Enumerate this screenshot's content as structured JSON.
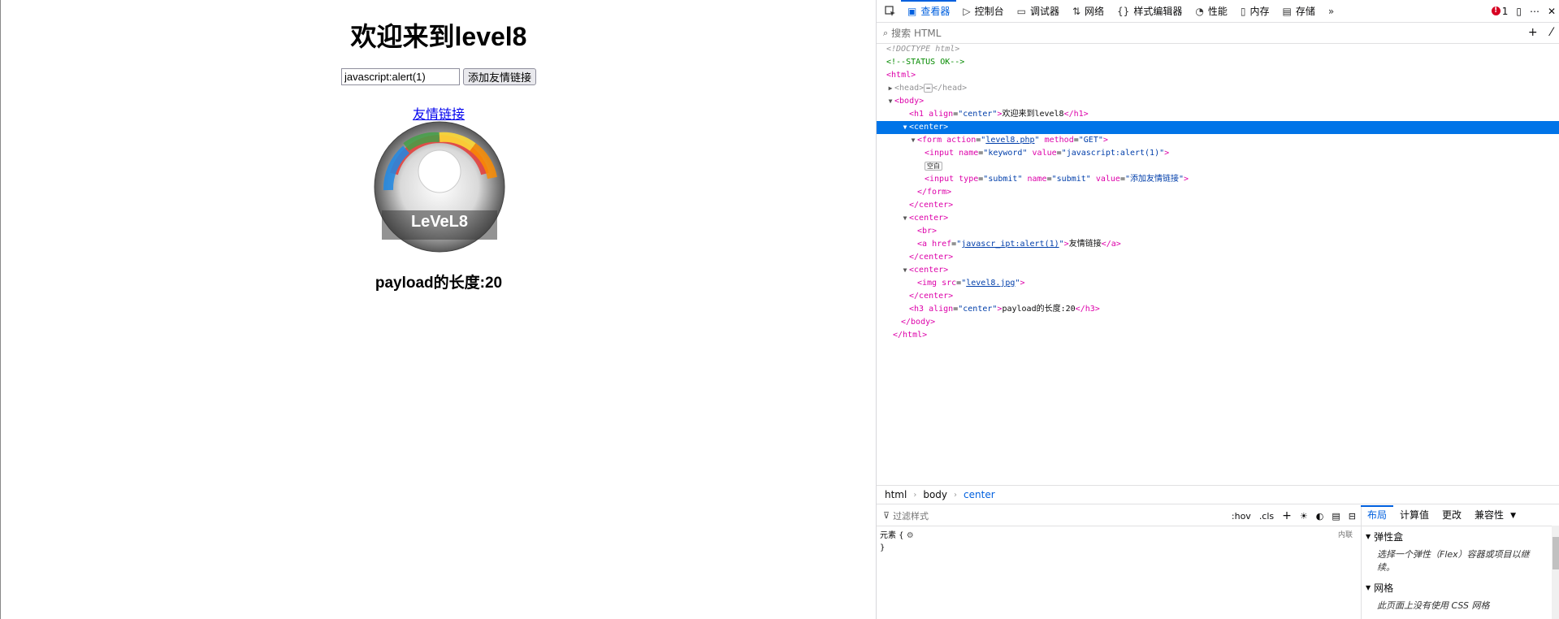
{
  "page": {
    "title": "欢迎来到level8",
    "keyword_value": "javascript:alert(1)",
    "submit_label": "添加友情链接",
    "link_text": "友情链接",
    "disc_text": "LeVeL8",
    "payload_text": "payload的长度:20"
  },
  "devtools": {
    "tabs": [
      {
        "icon": "picker-icon",
        "label": ""
      },
      {
        "icon": "inspector-icon",
        "label": "查看器"
      },
      {
        "icon": "console-icon",
        "label": "控制台"
      },
      {
        "icon": "debugger-icon",
        "label": "调试器"
      },
      {
        "icon": "network-icon",
        "label": "网络"
      },
      {
        "icon": "style-editor-icon",
        "label": "样式编辑器"
      },
      {
        "icon": "performance-icon",
        "label": "性能"
      },
      {
        "icon": "memory-icon",
        "label": "内存"
      },
      {
        "icon": "storage-icon",
        "label": "存储"
      }
    ],
    "active_tab": "查看器",
    "error_count": "1",
    "search_placeholder": "搜索 HTML",
    "markup": {
      "doctype": "<!DOCTYPE html>",
      "comment": "<!--STATUS OK-->",
      "html_open": "html",
      "head_collapsed": "head",
      "body_open": "body",
      "h1_attr": "align",
      "h1_val": "center",
      "h1_text": "欢迎来到level8",
      "center": "center",
      "form_action_attr": "action",
      "form_action_val": "level8.php",
      "form_method_attr": "method",
      "form_method_val": "GET",
      "input1_name_attr": "name",
      "input1_name_val": "keyword",
      "input1_value_attr": "value",
      "input1_value_val": "javascript:alert(1)",
      "whitespace_badge": "空白",
      "input2_type_attr": "type",
      "input2_type_val": "submit",
      "input2_name_attr": "name",
      "input2_name_val": "submit",
      "input2_value_attr": "value",
      "input2_value_val": "添加友情链接",
      "a_href_attr": "href",
      "a_href_val": "javascr_ipt:alert(1)",
      "a_text": "友情链接",
      "img_src_attr": "src",
      "img_src_val": "level8.jpg",
      "h3_attr": "align",
      "h3_val": "center",
      "h3_text": "payload的长度:20"
    },
    "breadcrumbs": [
      "html",
      "body",
      "center"
    ],
    "rules": {
      "filter_placeholder": "过滤样式",
      "hov": ":hov",
      "cls": ".cls",
      "element_rule": "元素 {",
      "element_close": "}",
      "inline_label": "内联"
    },
    "side": {
      "tabs": [
        "布局",
        "计算值",
        "更改",
        "兼容性"
      ],
      "active_tab": "布局",
      "flexbox_title": "弹性盒",
      "flexbox_desc": "选择一个弹性（Flex）容器或项目以继续。",
      "grid_title": "网格",
      "grid_desc": "此页面上没有使用 CSS 网格"
    }
  }
}
